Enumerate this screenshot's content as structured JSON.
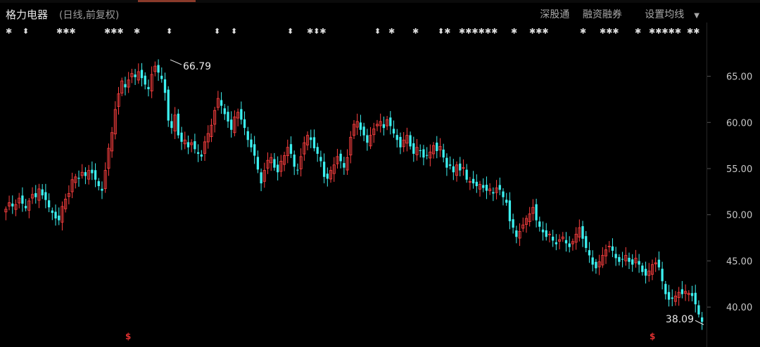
{
  "header": {
    "title": "格力电器",
    "subtitle": "(日线,前复权)",
    "links": [
      "深股通",
      "融资融券",
      "设置均线"
    ]
  },
  "event_markers": [
    "✱",
    "⬍",
    "✱✱✱",
    "✱✱✱",
    "✱",
    "⬍",
    "⬍",
    "⬍",
    "⬍",
    "✱⬍✱",
    "⬍",
    "✱",
    "✱",
    "⬍✱",
    "✱✱✱✱✱✱",
    "✱",
    "✱✱✱",
    "✱",
    "✱✱✱",
    "✱",
    "✱✱✱✱✱",
    "✱✱"
  ],
  "bottom_markers": [
    "$",
    "$"
  ],
  "colors": {
    "up": "#ff4040",
    "down": "#3cf0f0",
    "background": "#000000"
  },
  "chart_data": {
    "type": "candlestick",
    "ylim": [
      37.5,
      69.0
    ],
    "yticks": [
      "65.00",
      "60.00",
      "55.00",
      "50.00",
      "45.00",
      "40.00"
    ],
    "ytick_values": [
      65,
      60,
      55,
      50,
      45,
      40
    ],
    "annotations": [
      {
        "label": "66.79",
        "value": 66.79,
        "position": "top"
      },
      {
        "label": "38.09",
        "value": 38.09,
        "position": "bottom-right"
      }
    ],
    "series_closes": [
      50.6,
      51.3,
      50.9,
      51.1,
      51.8,
      51.2,
      50.7,
      51.5,
      52.2,
      51.9,
      52.8,
      52.1,
      51.6,
      50.8,
      50.2,
      49.6,
      49.4,
      50.9,
      51.7,
      52.3,
      53.8,
      54.1,
      53.9,
      54.6,
      54.2,
      54.8,
      54.5,
      53.8,
      53.1,
      52.6,
      54.8,
      57.2,
      58.9,
      61.4,
      63.1,
      64.5,
      63.8,
      64.6,
      65.3,
      64.9,
      65.5,
      64.8,
      64.1,
      63.6,
      65.2,
      66.1,
      65.4,
      64.7,
      63.2,
      60.2,
      59.4,
      60.8,
      58.6,
      57.9,
      58.1,
      57.3,
      57.8,
      57.1,
      56.6,
      56.3,
      57.9,
      58.8,
      59.7,
      61.3,
      62.6,
      61.8,
      60.9,
      60.1,
      59.2,
      60.6,
      61.1,
      60.3,
      59.4,
      58.1,
      57.3,
      56.4,
      54.9,
      53.4,
      54.8,
      55.9,
      56.2,
      55.1,
      54.6,
      55.8,
      56.4,
      57.3,
      56.6,
      55.2,
      54.8,
      56.3,
      57.8,
      58.6,
      58.1,
      57.2,
      56.6,
      55.8,
      54.1,
      53.9,
      54.8,
      55.4,
      56.3,
      55.8,
      55.1,
      56.2,
      58.4,
      59.8,
      60.1,
      59.2,
      58.6,
      57.8,
      58.6,
      59.3,
      59.8,
      60.1,
      59.4,
      60.3,
      59.6,
      58.8,
      58.1,
      57.3,
      58.1,
      58.6,
      57.4,
      56.6,
      57.3,
      56.9,
      56.2,
      56.4,
      56.8,
      57.5,
      56.9,
      57.4,
      56.2,
      55.1,
      55.3,
      54.6,
      55.4,
      54.8,
      55.1,
      53.8,
      53.6,
      53.4,
      53.1,
      53.3,
      52.9,
      52.6,
      52.8,
      52.3,
      52.9,
      52.7,
      51.9,
      51.3,
      49.3,
      48.6,
      47.6,
      48.2,
      48.9,
      49.6,
      50.1,
      50.8,
      49.4,
      48.7,
      48.1,
      47.6,
      47.9,
      47.2,
      46.8,
      47.3,
      47.6,
      46.9,
      46.5,
      47.1,
      47.9,
      48.6,
      47.4,
      46.4,
      45.6,
      44.6,
      44.2,
      44.9,
      45.6,
      46.2,
      46.6,
      46.1,
      45.3,
      44.9,
      45.2,
      45.6,
      44.9,
      44.6,
      45.3,
      44.6,
      43.8,
      43.4,
      43.9,
      44.6,
      44.8,
      44.3,
      42.8,
      41.4,
      40.8,
      40.9,
      41.2,
      41.6,
      41.4,
      41.7,
      41.5,
      41.2,
      40.3,
      39.2,
      38.4
    ]
  }
}
